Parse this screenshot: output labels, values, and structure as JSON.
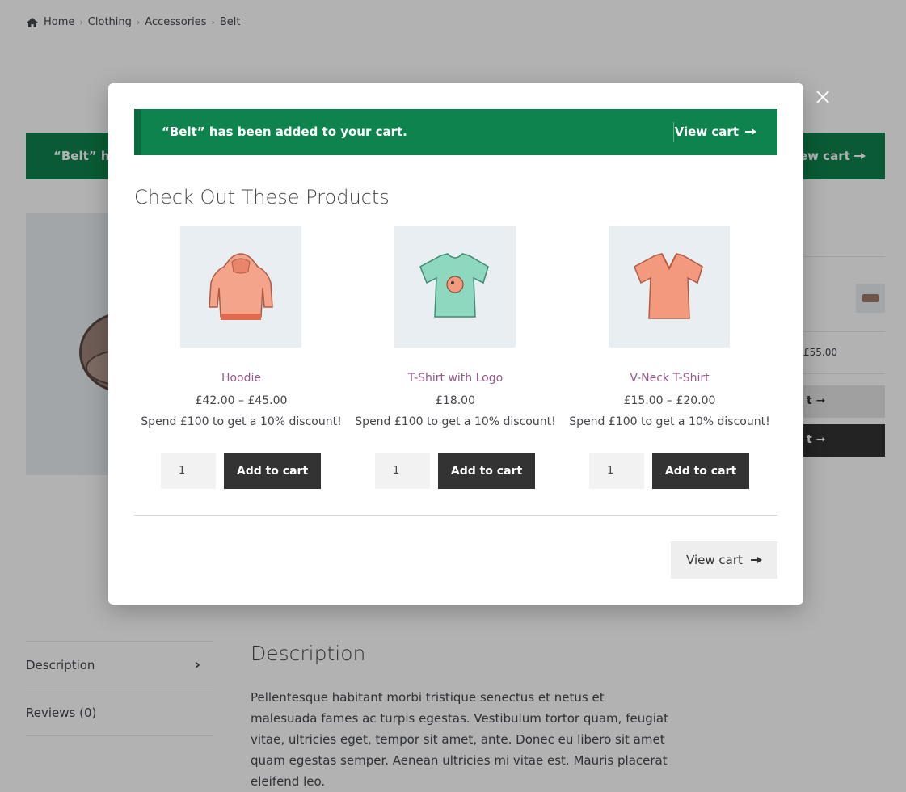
{
  "breadcrumb": {
    "items": [
      "Home",
      "Clothing",
      "Accessories",
      "Belt"
    ],
    "separator": "›"
  },
  "background": {
    "notice": {
      "message": "“Belt” has been added to your cart.",
      "view_cart": "View cart"
    },
    "price_partial": "£55.00",
    "tabs": [
      {
        "label": "Description"
      },
      {
        "label": "Reviews (0)"
      }
    ],
    "description": {
      "title": "Description",
      "body": "Pellentesque habitant morbi tristique senectus et netus et malesuada fames ac turpis egestas. Vestibulum tortor quam, feugiat vitae, ultricies eget, tempor sit amet, ante. Donec eu libero sit amet quam egestas semper. Aenean ultricies mi vitae est. Mauris placerat eleifend leo."
    }
  },
  "modal": {
    "notice": {
      "message": "“Belt” has been added to your cart.",
      "view_cart": "View cart"
    },
    "heading": "Check Out These Products",
    "products": [
      {
        "name": "Hoodie",
        "price": "£42.00 – £45.00",
        "promo": "Spend £100 to get a 10% discount!",
        "qty": "1",
        "button": "Add to cart",
        "color": "#f3a48a"
      },
      {
        "name": "T-Shirt with Logo",
        "price": "£18.00",
        "promo": "Spend £100 to get a 10% discount!",
        "qty": "1",
        "button": "Add to cart",
        "color": "#8fd8c0"
      },
      {
        "name": "V-Neck T-Shirt",
        "price": "£15.00 – £20.00",
        "promo": "Spend £100 to get a 10% discount!",
        "qty": "1",
        "button": "Add to cart",
        "color": "#f39a7e"
      }
    ],
    "footer_view_cart": "View cart"
  },
  "colors": {
    "success": "#0f834d",
    "primary_button": "#333333",
    "link": "#96588a"
  }
}
